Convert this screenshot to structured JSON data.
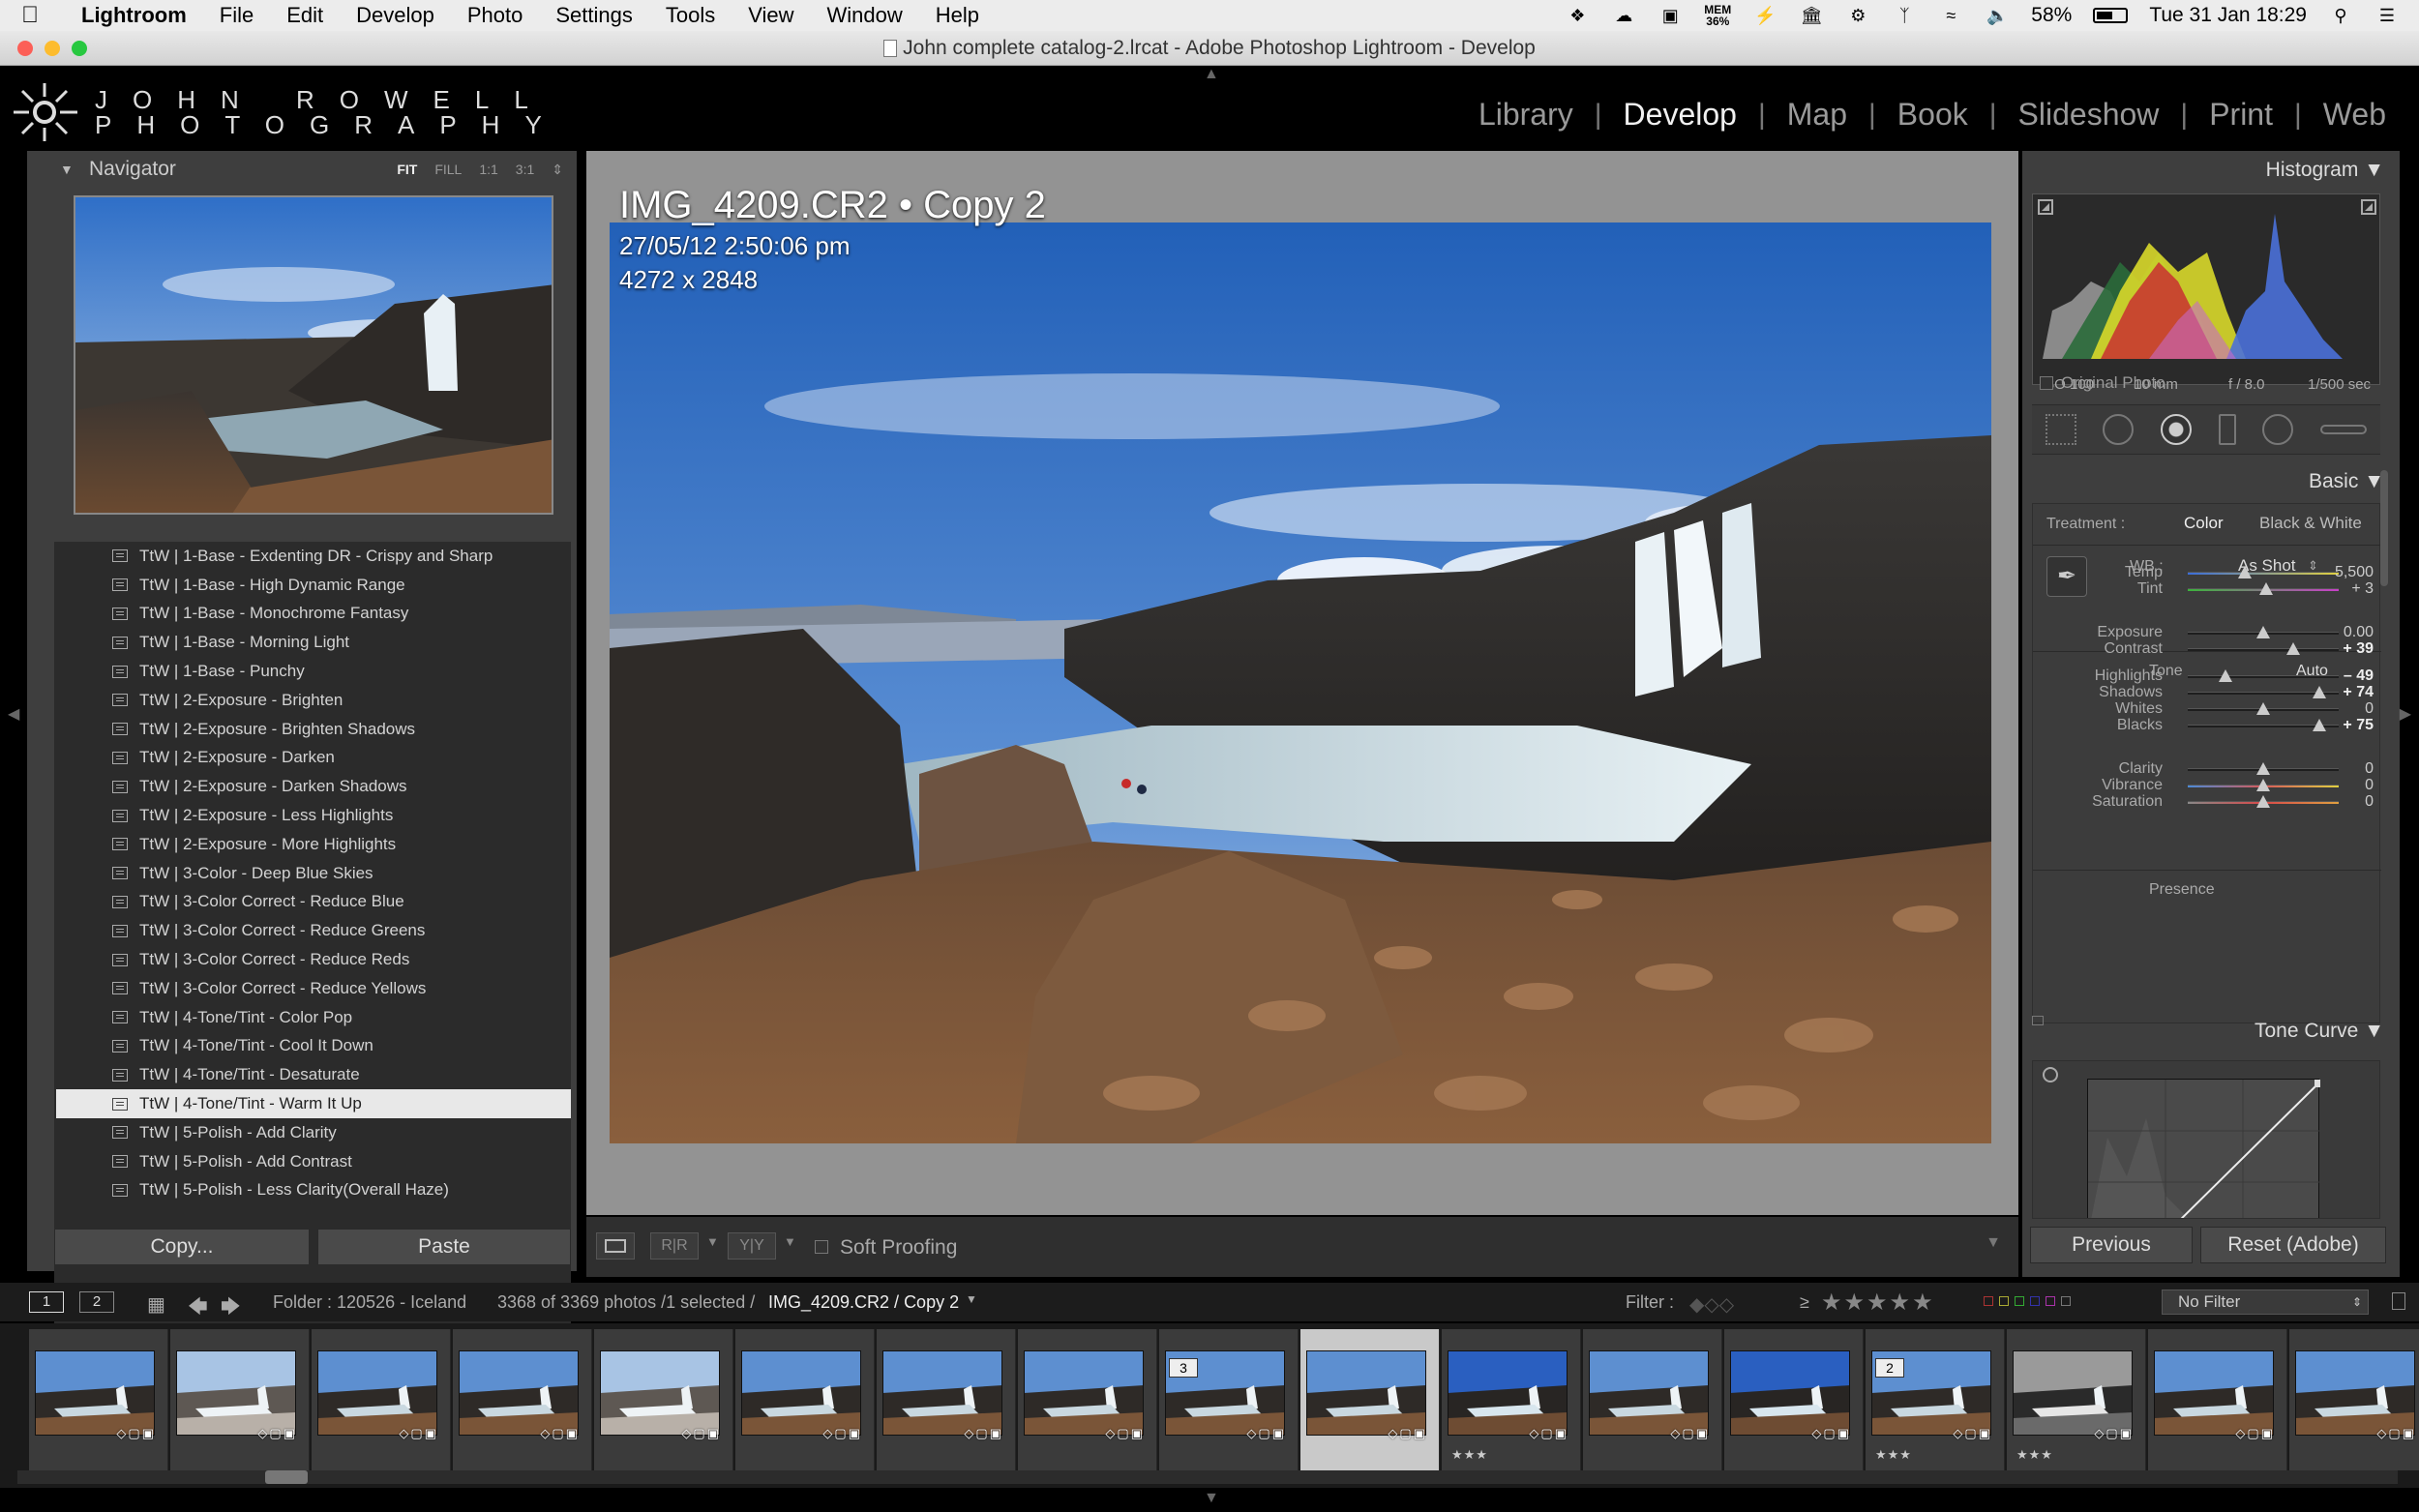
{
  "menubar": {
    "app": "Lightroom",
    "items": [
      "File",
      "Edit",
      "Develop",
      "Photo",
      "Settings",
      "Tools",
      "View",
      "Window",
      "Help"
    ],
    "mem_label": "MEM",
    "mem_value": "36%",
    "battery": "58%",
    "clock": "Tue 31 Jan  18:29"
  },
  "window": {
    "title": "John complete catalog-2.lrcat - Adobe Photoshop Lightroom - Develop"
  },
  "identity": {
    "line1": "JOHN ROWELL",
    "line2": "PHOTOGRAPHY"
  },
  "modules": [
    "Library",
    "Develop",
    "Map",
    "Book",
    "Slideshow",
    "Print",
    "Web"
  ],
  "navigator": {
    "title": "Navigator",
    "zoom": [
      "FIT",
      "FILL",
      "1:1",
      "3:1"
    ]
  },
  "presets": [
    "TtW | 1-Base - Exdenting DR - Crispy and Sharp",
    "TtW | 1-Base - High Dynamic Range",
    "TtW | 1-Base - Monochrome Fantasy",
    "TtW | 1-Base - Morning Light",
    "TtW | 1-Base - Punchy",
    "TtW | 2-Exposure - Brighten",
    "TtW | 2-Exposure - Brighten Shadows",
    "TtW | 2-Exposure - Darken",
    "TtW | 2-Exposure - Darken Shadows",
    "TtW | 2-Exposure - Less Highlights",
    "TtW | 2-Exposure - More Highlights",
    "TtW | 3-Color - Deep Blue Skies",
    "TtW | 3-Color Correct - Reduce Blue",
    "TtW | 3-Color Correct - Reduce Greens",
    "TtW | 3-Color Correct - Reduce Reds",
    "TtW | 3-Color Correct - Reduce Yellows",
    "TtW | 4-Tone/Tint - Color Pop",
    "TtW | 4-Tone/Tint - Cool It Down",
    "TtW | 4-Tone/Tint - Desaturate",
    "TtW | 4-Tone/Tint - Warm It Up",
    "TtW | 5-Polish - Add Clarity",
    "TtW | 5-Polish - Add Contrast",
    "TtW | 5-Polish - Less Clarity(Overall Haze)"
  ],
  "selected_preset": "TtW | 4-Tone/Tint - Warm It Up",
  "left_buttons": {
    "copy": "Copy...",
    "paste": "Paste"
  },
  "photo_info": {
    "filename": "IMG_4209.CR2  •  Copy 2",
    "datetime": "27/05/12 2:50:06 pm",
    "dimensions": "4272 x 2848"
  },
  "toolbar": {
    "soft_proofing": "Soft Proofing",
    "before_after": "R|R",
    "yy": "Y|Y"
  },
  "histogram": {
    "title": "Histogram",
    "iso": "ISO 100",
    "focal": "10 mm",
    "aperture": "f / 8.0",
    "shutter": "1/500 sec",
    "original_photo": "Original Photo"
  },
  "basic": {
    "title": "Basic",
    "treatment_label": "Treatment :",
    "treatment_color": "Color",
    "treatment_bw": "Black & White",
    "wb_label": "WB :",
    "wb_value": "As Shot",
    "tone_label": "Tone",
    "auto_label": "Auto",
    "presence_label": "Presence",
    "sliders": [
      {
        "label": "Temp",
        "value": "5,500",
        "pos": 0.38
      },
      {
        "label": "Tint",
        "value": "+ 3",
        "pos": 0.52
      },
      {
        "label": "Exposure",
        "value": "0.00",
        "pos": 0.5
      },
      {
        "label": "Contrast",
        "value": "+ 39",
        "pos": 0.7
      },
      {
        "label": "Highlights",
        "value": "– 49",
        "pos": 0.25
      },
      {
        "label": "Shadows",
        "value": "+ 74",
        "pos": 0.87
      },
      {
        "label": "Whites",
        "value": "0",
        "pos": 0.5
      },
      {
        "label": "Blacks",
        "value": "+ 75",
        "pos": 0.87
      },
      {
        "label": "Clarity",
        "value": "0",
        "pos": 0.5
      },
      {
        "label": "Vibrance",
        "value": "0",
        "pos": 0.5
      },
      {
        "label": "Saturation",
        "value": "0",
        "pos": 0.5
      }
    ]
  },
  "tone_curve": {
    "title": "Tone Curve"
  },
  "right_buttons": {
    "previous": "Previous",
    "reset": "Reset (Adobe)"
  },
  "filmstrip_header": {
    "screen1": "1",
    "screen2": "2",
    "folder": "Folder : 120526 - Iceland",
    "count": "3368 of 3369 photos /1 selected /",
    "current": "IMG_4209.CR2 / Copy 2",
    "filter_label": "Filter :",
    "filter_value": "No Filter",
    "stars_prefix": "≥"
  },
  "filmstrip": {
    "cells": [
      {
        "badge": "",
        "stars": "",
        "variant": "normal"
      },
      {
        "badge": "",
        "stars": "",
        "variant": "bright"
      },
      {
        "badge": "",
        "stars": "",
        "variant": "normal"
      },
      {
        "badge": "",
        "stars": "",
        "variant": "normal"
      },
      {
        "badge": "",
        "stars": "",
        "variant": "bright"
      },
      {
        "badge": "",
        "stars": "",
        "variant": "normal"
      },
      {
        "badge": "",
        "stars": "",
        "variant": "normal"
      },
      {
        "badge": "",
        "stars": "",
        "variant": "normal"
      },
      {
        "badge": "3",
        "stars": "",
        "variant": "normal"
      },
      {
        "badge": "",
        "stars": "",
        "variant": "selected"
      },
      {
        "badge": "",
        "stars": "★★★",
        "variant": "blue"
      },
      {
        "badge": "",
        "stars": "",
        "variant": "normal"
      },
      {
        "badge": "",
        "stars": "",
        "variant": "blue"
      },
      {
        "badge": "2",
        "stars": "★★★",
        "variant": "normal"
      },
      {
        "badge": "",
        "stars": "★★★",
        "variant": "mono"
      },
      {
        "badge": "",
        "stars": "",
        "variant": "normal"
      },
      {
        "badge": "",
        "stars": "",
        "variant": "normal"
      }
    ]
  }
}
